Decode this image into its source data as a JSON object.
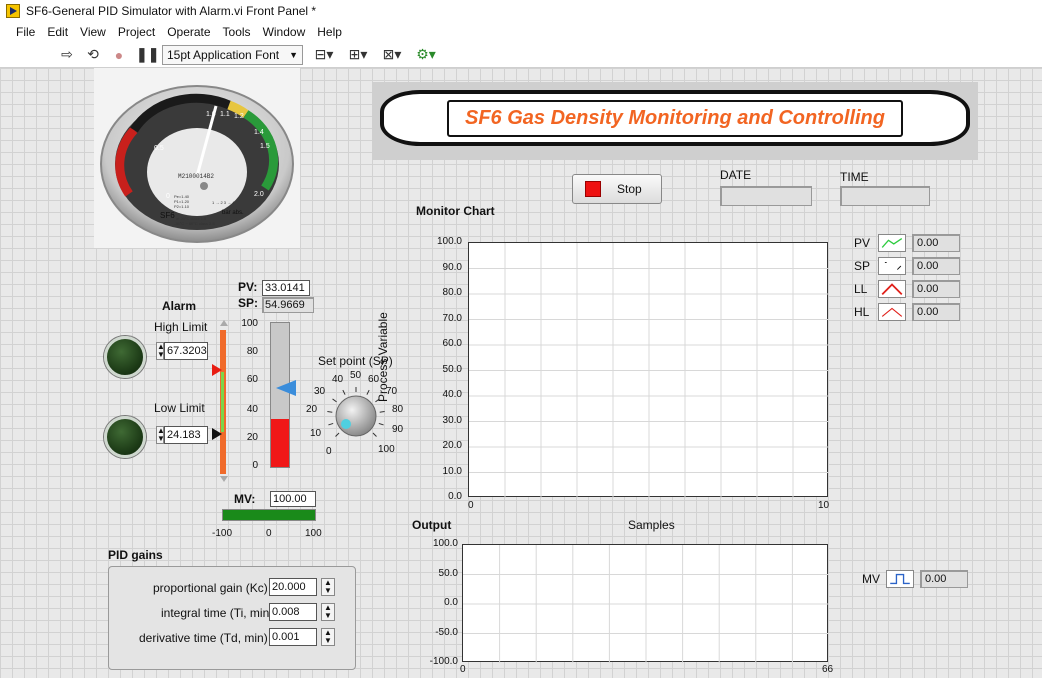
{
  "window": {
    "title": "SF6-General PID Simulator with Alarm.vi Front Panel *"
  },
  "menu": [
    "File",
    "Edit",
    "View",
    "Project",
    "Operate",
    "Tools",
    "Window",
    "Help"
  ],
  "toolbar": {
    "font": "15pt Application Font"
  },
  "banner": {
    "title": "SF6 Gas Density Monitoring and Controlling"
  },
  "gauge": {
    "scale": [
      "0",
      "0.5",
      "1.0",
      "1.1",
      "1.2",
      "1.4",
      "1.5",
      "2.0"
    ],
    "serial": "M2100014B2",
    "unit": "bar abs.",
    "brand": "SF6",
    "specs": [
      "Pe=1.40",
      "P1=1.20",
      "P2=1.10",
      "at 20°C class 1.5",
      "-35°C ~ 60°C class 2.5"
    ],
    "legend": "1 → 2  3 → 4"
  },
  "stop": {
    "label": "Stop"
  },
  "date": {
    "label": "DATE",
    "value": ""
  },
  "time": {
    "label": "TIME",
    "value": ""
  },
  "alarm": {
    "title": "Alarm",
    "high_label": "High Limit",
    "high_value": "67.3203",
    "low_label": "Low Limit",
    "low_value": "24.183"
  },
  "pv": {
    "label": "PV:",
    "value": "33.0141"
  },
  "sp": {
    "label": "SP:",
    "value": "54.9669"
  },
  "tank": {
    "ticks": [
      "100",
      "80",
      "60",
      "40",
      "20",
      "0"
    ],
    "level": 0.33,
    "sp_level": 0.55
  },
  "setpoint_knob": {
    "label": "Set point (SP)",
    "ticks": [
      "0",
      "10",
      "20",
      "30",
      "40",
      "50",
      "60",
      "70",
      "80",
      "90",
      "100"
    ]
  },
  "mv": {
    "label": "MV:",
    "value": "100.00",
    "bar_fraction": 1.0,
    "ticks": [
      "-100",
      "0",
      "100"
    ]
  },
  "monitor_chart": {
    "title": "Monitor Chart",
    "ylabel": "Process Variable",
    "xlabel": "Samples",
    "y_ticks": [
      "100.0",
      "90.0",
      "80.0",
      "70.0",
      "60.0",
      "50.0",
      "40.0",
      "30.0",
      "20.0",
      "10.0",
      "0.0"
    ],
    "x_ticks": [
      "0",
      "10"
    ]
  },
  "legend": [
    {
      "name": "PV",
      "value": "0.00",
      "color": "#2ecc40"
    },
    {
      "name": "SP",
      "value": "0.00",
      "color": "#111111"
    },
    {
      "name": "LL",
      "value": "0.00",
      "color": "#e0201a"
    },
    {
      "name": "HL",
      "value": "0.00",
      "color": "#e0201a"
    }
  ],
  "output_chart": {
    "title": "Output",
    "y_ticks": [
      "100.0",
      "50.0",
      "0.0",
      "-50.0",
      "-100.0"
    ],
    "x_ticks": [
      "0",
      "66"
    ]
  },
  "mv_legend": {
    "name": "MV",
    "value": "0.00",
    "color": "#2b63c8"
  },
  "pid": {
    "title": "PID gains",
    "kc_label": "proportional gain (Kc)",
    "kc": "20.000",
    "ti_label": "integral time (Ti, min)",
    "ti": "0.008",
    "td_label": "derivative time (Td, min)",
    "td": "0.001"
  }
}
